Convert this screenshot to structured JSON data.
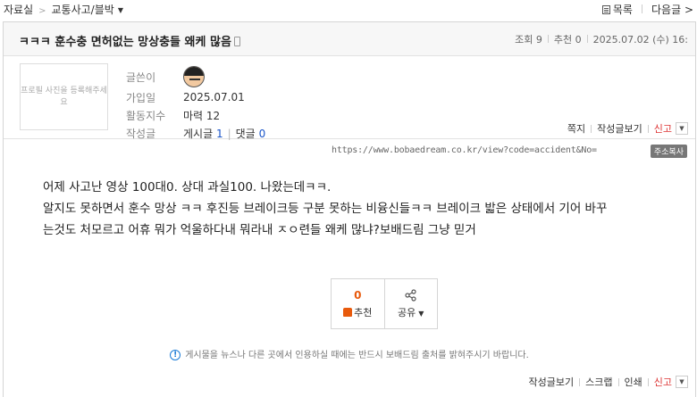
{
  "breadcrumb": {
    "root": "자료실",
    "separator": ">",
    "board": "교통사고/블박"
  },
  "nav": {
    "list_label": "목록",
    "next_label": "다음글"
  },
  "post": {
    "title": "ㅋㅋㅋ 훈수충 면허없는 망상충들 왜케 많음",
    "views_label": "조회 9",
    "recommend_label": "추천 0",
    "date": "2025.07.02 (수) 16:"
  },
  "profile": {
    "photo_placeholder": "프로필 사진을 등록해주세요",
    "author_label": "글쓴이",
    "joined_label": "가입일",
    "joined_value": "2025.07.01",
    "activity_label": "활동지수",
    "activity_value": "마력 12",
    "posts_label": "작성글",
    "posts_text": "게시글",
    "posts_count": "1",
    "comments_text": "댓글",
    "comments_count": "0",
    "actions": {
      "message": "쪽지",
      "view_posts": "작성글보기",
      "report": "신고"
    }
  },
  "url": {
    "text": "https://www.bobaedream.co.kr/view?code=accident&No=",
    "copy_label": "주소복사"
  },
  "content": {
    "lines": [
      "어제 사고난 영상 100대0. 상대 과실100. 나왔는데ㅋㅋ.",
      "알지도 못하면서 훈수 망상 ㅋㅋ 후진등 브레이크등 구분 못하는 비융신들ㅋㅋ 브레이크 밟은 상태에서 기어 바꾸",
      "는것도 처모르고 어휴 뭐가 억울하다내 뭐라내 ㅈㅇ련들 왜케 많냐?보배드림 그냥 믿거"
    ]
  },
  "reactions": {
    "recommend_count": "0",
    "recommend_label": "추천",
    "share_label": "공유"
  },
  "notice": "게시물을 뉴스나 다른 곳에서 인용하실 때에는 반드시 보배드림 출처를 밝혀주시기 바랍니다.",
  "bottom_actions": {
    "view_posts": "작성글보기",
    "scrap": "스크랩",
    "print": "인쇄",
    "report": "신고"
  },
  "colors": {
    "accent_orange": "#e85a0c",
    "link_blue": "#1a55c9",
    "report_red": "#d33333",
    "info_blue": "#1a7bd6"
  }
}
